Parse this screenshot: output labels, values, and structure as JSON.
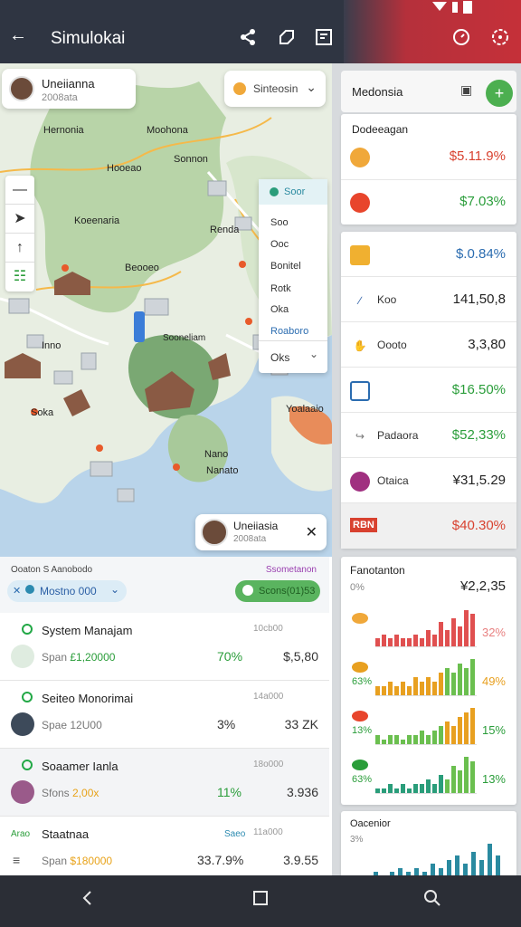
{
  "app": {
    "title": "Simulokai"
  },
  "map": {
    "user_chip": {
      "name": "Uneiianna",
      "sub": "2008ata"
    },
    "search_chip": {
      "label": "Sinteosin"
    },
    "labels": [
      "Hernonia",
      "Moohona",
      "Hooeao",
      "Sonnon",
      "Koeenaria",
      "Renda",
      "Beooeo",
      "Inno",
      "Soka",
      "Yoalaaio",
      "Nano",
      "Nanato",
      "Sooneliam"
    ],
    "layers": {
      "header": "Soor",
      "items": [
        "Soo",
        "Ooc",
        "Bonitel",
        "Rotk",
        "Oka",
        "Roaboro",
        "Oks"
      ]
    },
    "bottom_chip": {
      "name": "Uneiiasia",
      "sub": "2008ata"
    }
  },
  "list": {
    "header": {
      "title": "Ooaton S Aanobodo",
      "link": "Ssometanon",
      "dropdown": "Mostno 000",
      "green_pill": "Scons(01)53"
    },
    "rows": [
      {
        "name": "System Manajam",
        "span_label": "Span",
        "span_val": "£1,20000",
        "time": "10cb00",
        "pct": "70%",
        "pct_color": "#2a9d3a",
        "amount": "$,5,80"
      },
      {
        "name": "Seiteo Monorimai",
        "span_label": "Spae",
        "span_val": "12U00",
        "time": "14a000",
        "pct": "3%",
        "pct_color": "#333",
        "amount": "33 ZK"
      },
      {
        "name": "Soaamer Ianla",
        "span_label": "Sfons",
        "span_val": "2,00x",
        "time": "18o000",
        "pct": "11%",
        "pct_color": "#2a9d3a",
        "amount": "3.936"
      },
      {
        "name": "Staatnaa",
        "span_label": "Span",
        "span_val": "$180000",
        "time": "11a000",
        "pct": "33.7.9%",
        "pct_color": "#333",
        "amount": "3.9.55",
        "prefix": "Arao",
        "pre2": "Saeo"
      }
    ]
  },
  "right": {
    "header": {
      "title": "Medonsia"
    },
    "card1": {
      "title": "Dodeeagan",
      "rows": [
        {
          "value": "$5.11.9%",
          "color": "#d8412f",
          "icon_color": "#f0a83a"
        },
        {
          "value": "$7.03%",
          "color": "#2a9d3a",
          "icon_color": "#e8452c"
        }
      ]
    },
    "card2": {
      "rows": [
        {
          "label": "",
          "value": "$.0.84%",
          "color": "#2b6cb0",
          "icon": "#f0b030"
        },
        {
          "label": "Koo",
          "value": "141,50,8",
          "color": "#222",
          "icon": "#2b5fa5"
        },
        {
          "label": "Oooto",
          "value": "3,3,80",
          "color": "#222",
          "icon": "#2b6cb0"
        },
        {
          "label": "",
          "value": "$16.50%",
          "color": "#2a9d3a",
          "icon": "#2b6cb0"
        },
        {
          "label": "Padaora",
          "value": "$52,33%",
          "color": "#2a9d3a",
          "icon": "#777"
        },
        {
          "label": "Otaica",
          "value": "¥31,5.29",
          "color": "#222",
          "icon": "#a03080"
        },
        {
          "label": "RBN",
          "value": "$40.30%",
          "color": "#d8412f",
          "icon": "#d8412f"
        }
      ]
    },
    "card3": {
      "title": "Fanotanton",
      "sub": "0%",
      "top_value": "¥2,2,35",
      "charts": [
        {
          "left": "",
          "pct": "32%",
          "pct_color": "#e88080",
          "values": [
            2,
            3,
            2,
            3,
            2,
            2,
            3,
            2,
            4,
            3,
            6,
            4,
            7,
            5,
            9,
            8
          ],
          "colors": [
            "#e05050",
            "#e05050"
          ]
        },
        {
          "left": "63%",
          "pct": "49%",
          "pct_color": "#e8a020",
          "values": [
            2,
            2,
            3,
            2,
            3,
            2,
            4,
            3,
            4,
            3,
            5,
            6,
            5,
            7,
            6,
            8
          ],
          "colors": [
            "#6bbf4f",
            "#e8a020"
          ]
        },
        {
          "left": "13%",
          "pct": "15%",
          "pct_color": "#2a9d3a",
          "values": [
            2,
            1,
            2,
            2,
            1,
            2,
            2,
            3,
            2,
            3,
            4,
            5,
            4,
            6,
            7,
            8
          ],
          "colors": [
            "#e8a020",
            "#6bbf4f"
          ]
        },
        {
          "left": "63%",
          "pct": "13%",
          "pct_color": "#2a9d3a",
          "values": [
            1,
            1,
            2,
            1,
            2,
            1,
            2,
            2,
            3,
            2,
            4,
            3,
            6,
            5,
            8,
            7
          ],
          "colors": [
            "#6bbf4f",
            "#2a9d7a"
          ]
        }
      ]
    },
    "card4": {
      "title": "Oacenior",
      "sub": "3%",
      "values": [
        2,
        1,
        2,
        3,
        2,
        3,
        2,
        4,
        3,
        5,
        6,
        4,
        7,
        5,
        9,
        6
      ],
      "color": "#2a8aa0"
    }
  },
  "nav": {
    "back": "‹",
    "home": "▢",
    "search": "⌕"
  }
}
